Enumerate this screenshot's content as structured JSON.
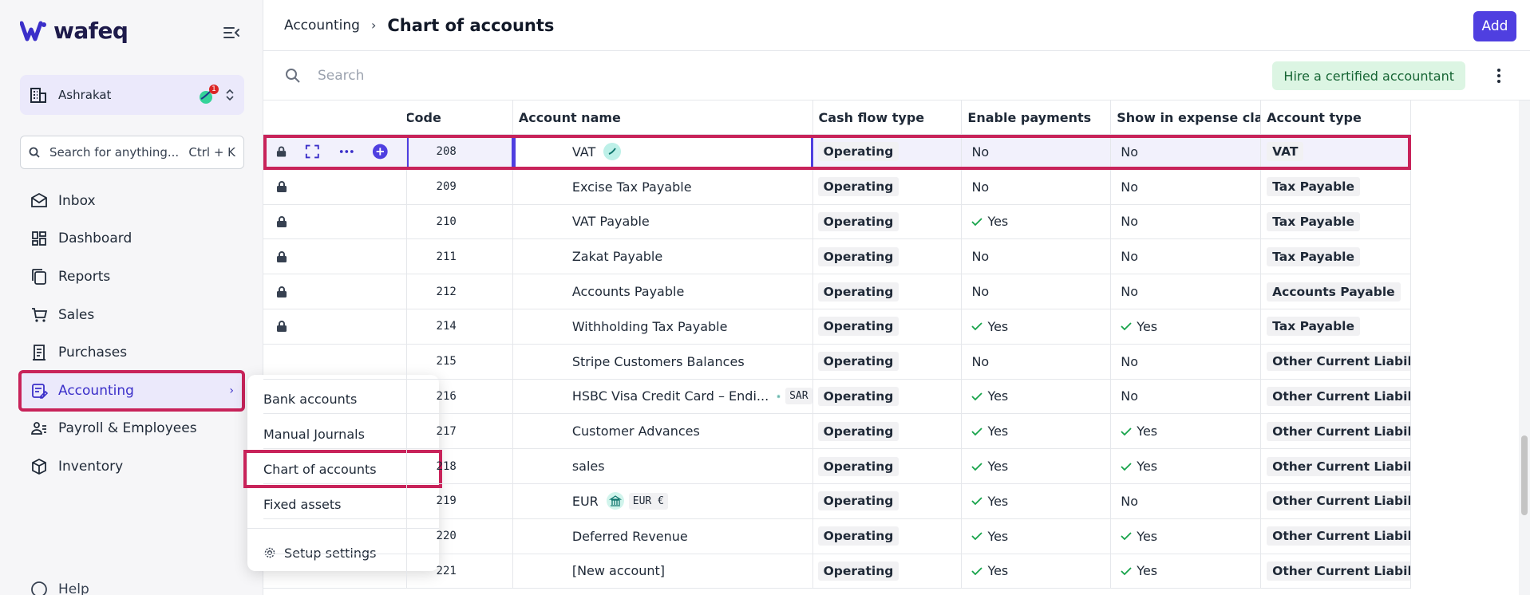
{
  "app": {
    "name": "wafeq"
  },
  "org": {
    "name": "Ashrakat",
    "notification_count": "1"
  },
  "search": {
    "placeholder": "Search for anything...",
    "shortcut": "Ctrl + K"
  },
  "nav": [
    {
      "label": "Inbox",
      "icon": "inbox-icon"
    },
    {
      "label": "Dashboard",
      "icon": "dashboard-icon"
    },
    {
      "label": "Reports",
      "icon": "reports-icon"
    },
    {
      "label": "Sales",
      "icon": "cart-icon"
    },
    {
      "label": "Purchases",
      "icon": "receipt-icon"
    },
    {
      "label": "Accounting",
      "icon": "accounting-icon",
      "active": true
    },
    {
      "label": "Payroll & Employees",
      "icon": "employees-icon"
    },
    {
      "label": "Inventory",
      "icon": "box-icon"
    }
  ],
  "help_label": "Help",
  "submenu": {
    "items": [
      "Bank accounts",
      "Manual Journals",
      "Chart of accounts",
      "Fixed assets"
    ],
    "settings": "Setup settings"
  },
  "header": {
    "breadcrumb": "Accounting",
    "separator": "›",
    "title": "Chart of accounts",
    "add_label": "Add"
  },
  "toolbar": {
    "search_placeholder": "Search",
    "hire_label": "Hire a certified accountant"
  },
  "table": {
    "columns": [
      "Code",
      "Account name",
      "Cash flow type",
      "Enable payments",
      "Show in expense cla...",
      "Account type"
    ],
    "rows": [
      {
        "code": "208",
        "name": "VAT",
        "cash": "Operating",
        "pay": "No",
        "exp": "No",
        "type": "VAT"
      },
      {
        "code": "209",
        "name": "Excise Tax Payable",
        "cash": "Operating",
        "pay": "No",
        "exp": "No",
        "type": "Tax Payable"
      },
      {
        "code": "210",
        "name": "VAT Payable",
        "cash": "Operating",
        "pay": "Yes",
        "exp": "No",
        "type": "Tax Payable"
      },
      {
        "code": "211",
        "name": "Zakat Payable",
        "cash": "Operating",
        "pay": "No",
        "exp": "No",
        "type": "Tax Payable"
      },
      {
        "code": "212",
        "name": "Accounts Payable",
        "cash": "Operating",
        "pay": "No",
        "exp": "No",
        "type": "Accounts Payable"
      },
      {
        "code": "214",
        "name": "Withholding Tax Payable",
        "cash": "Operating",
        "pay": "Yes",
        "exp": "Yes",
        "type": "Tax Payable"
      },
      {
        "code": "215",
        "name": "Stripe Customers Balances",
        "cash": "Operating",
        "pay": "No",
        "exp": "No",
        "type": "Other Current Liabilitie"
      },
      {
        "code": "216",
        "name": "HSBC Visa Credit Card – Endi...",
        "tag": "SAR",
        "cash": "Operating",
        "pay": "Yes",
        "exp": "No",
        "type": "Other Current Liabilitie"
      },
      {
        "code": "217",
        "name": "Customer Advances",
        "cash": "Operating",
        "pay": "Yes",
        "exp": "Yes",
        "type": "Other Current Liabilitie"
      },
      {
        "code": "218",
        "name": "sales",
        "cash": "Operating",
        "pay": "Yes",
        "exp": "Yes",
        "type": "Other Current Liabilitie"
      },
      {
        "code": "219",
        "name": "EUR",
        "tag": "EUR €",
        "cash": "Operating",
        "pay": "Yes",
        "exp": "No",
        "type": "Other Current Liabilitie"
      },
      {
        "code": "220",
        "name": "Deferred Revenue",
        "cash": "Operating",
        "pay": "Yes",
        "exp": "Yes",
        "type": "Other Current Liabilitie"
      },
      {
        "code": "221",
        "name": "[New account]",
        "cash": "Operating",
        "pay": "Yes",
        "exp": "Yes",
        "type": "Other Current Liabilitie"
      }
    ]
  }
}
